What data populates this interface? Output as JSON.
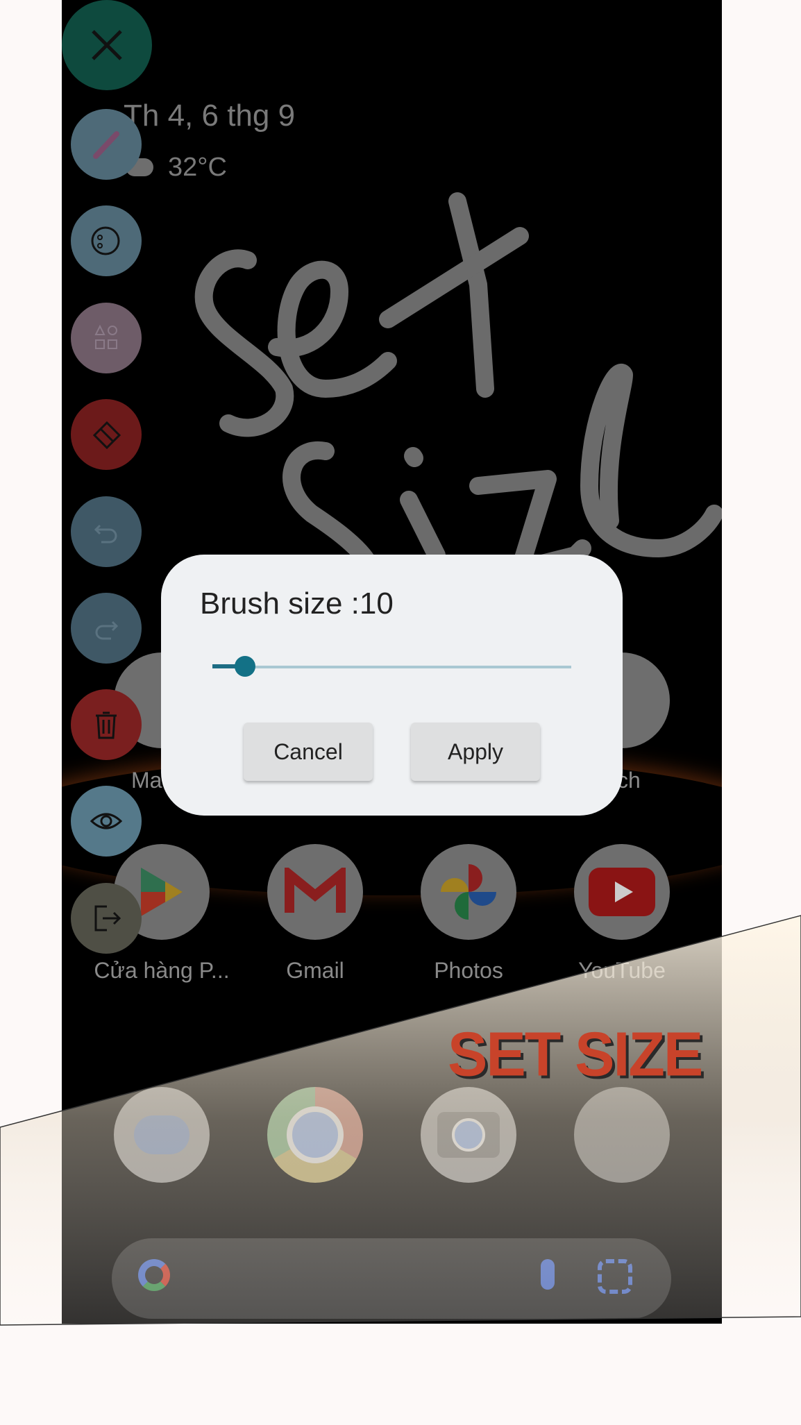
{
  "status": {
    "date": "Th 4, 6 thg 9",
    "weather": "32°C"
  },
  "apps_row1": [
    {
      "label": "Ma"
    },
    {
      "label": "ch"
    }
  ],
  "apps_row2": [
    {
      "label": "Cửa hàng P..."
    },
    {
      "label": "Gmail"
    },
    {
      "label": "Photos"
    },
    {
      "label": "YouTube"
    }
  ],
  "dock": [
    "messages",
    "chrome",
    "camera",
    "phone-chrome"
  ],
  "toolbar": [
    {
      "name": "brush",
      "color": "#4e6a78"
    },
    {
      "name": "palette",
      "color": "#4e6a78"
    },
    {
      "name": "shapes",
      "color": "#6e5c68"
    },
    {
      "name": "eraser",
      "color": "#6c1a1a"
    },
    {
      "name": "undo",
      "color": "#3f5866"
    },
    {
      "name": "redo",
      "color": "#3f5866"
    },
    {
      "name": "delete",
      "color": "#7a1f1f"
    },
    {
      "name": "preview",
      "color": "#55798a"
    },
    {
      "name": "exit",
      "color": "#4f4f45"
    }
  ],
  "drawing_text": "set size",
  "dialog": {
    "title": "Brush size :10",
    "slider_value": 10,
    "cancel_label": "Cancel",
    "apply_label": "Apply"
  },
  "caption": "SET SIZE",
  "colors": {
    "accent": "#137186",
    "caption": "#c8432a"
  }
}
